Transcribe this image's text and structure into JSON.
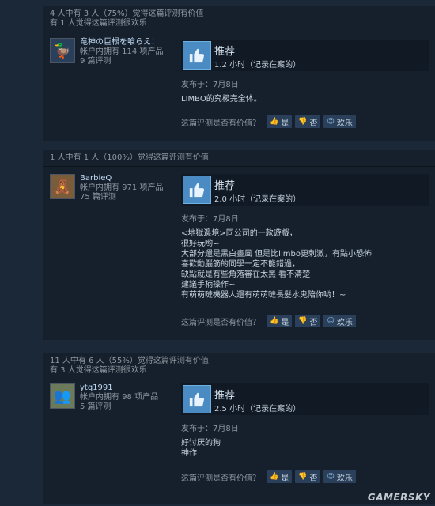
{
  "reviews": [
    {
      "helpful_lines": [
        "4 人中有 3 人（75%）觉得这篇评测有价值",
        "有 1 人觉得这篇评测很欢乐"
      ],
      "author": {
        "name": "竜神の巨根を喰らえ！",
        "products": "帐户内拥有 114 项产品",
        "reviews": "9 篇评测",
        "avatar_icon": "duck-icon"
      },
      "vote": "推荐",
      "hours": "1.2 小时（记录在案的）",
      "posted": "发布于：7月8日",
      "content": [
        "LIMBO的究极完全体。"
      ],
      "helpful_q": "这篇评测是否有价值？",
      "yes": "是",
      "no": "否",
      "funny": "欢乐"
    },
    {
      "helpful_lines": [
        "1 人中有 1 人（100%）觉得这篇评测有价值"
      ],
      "author": {
        "name": "BarbieQ",
        "products": "帐户内拥有 971 项产品",
        "reviews": "75 篇评测",
        "avatar_icon": "poster-icon"
      },
      "vote": "推荐",
      "hours": "2.0 小时（记录在案的）",
      "posted": "发布于：7月8日",
      "content": [
        "<地獄邊境>同公司的一款遊戲，",
        "很好玩哟~",
        "大部分還是黑白畫風 但是比limbo更刺激，有點小恐怖",
        "喜歡動腦筋的同學一定不能錯過，",
        "缺點就是有些角落審在太黑 看不清楚",
        "建議手柄操作~",
        "有萌萌噠機器人還有萌萌噠長髮水鬼陪你哟！~"
      ],
      "helpful_q": "这篇评测是否有价值？",
      "yes": "是",
      "no": "否",
      "funny": "欢乐"
    },
    {
      "helpful_lines": [
        "11 人中有 6 人（55%）觉得这篇评测有价值",
        "有 3 人觉得这篇评测很欢乐"
      ],
      "author": {
        "name": "ytq1991",
        "products": "帐户内拥有 98 项产品",
        "reviews": "5 篇评测",
        "avatar_icon": "photo-icon"
      },
      "vote": "推荐",
      "hours": "2.5 小时（记录在案的）",
      "posted": "发布于：7月8日",
      "content": [
        "好讨厌的狗",
        "神作"
      ],
      "helpful_q": "这篇评测是否有价值？",
      "yes": "是",
      "no": "否",
      "funny": "欢乐"
    }
  ],
  "watermark": "GAMERSKY",
  "colors": {
    "background": "#1b2838",
    "panel": "#16202d",
    "thumb": "#4a8bc4",
    "button": "#2a3f5a"
  }
}
